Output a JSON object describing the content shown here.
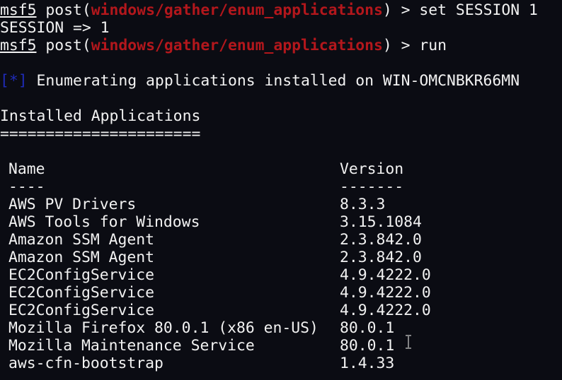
{
  "terminal": {
    "lines": {
      "cmd1": {
        "prompt": "msf5",
        "post_prefix": " post(",
        "module": "windows/gather/enum_applications",
        "post_suffix": ") > ",
        "command": "set SESSION 1"
      },
      "output1": "SESSION => 1",
      "cmd2": {
        "prompt": "msf5",
        "post_prefix": " post(",
        "module": "windows/gather/enum_applications",
        "post_suffix": ") > ",
        "command": "run"
      },
      "status": {
        "marker": "[*]",
        "text": " Enumerating applications installed on WIN-OMCNBKR66MN"
      },
      "section_title": "Installed Applications",
      "section_underline": "======================"
    },
    "table": {
      "headers": {
        "name": "Name",
        "version": "Version",
        "name_rule": "----",
        "version_rule": "-------"
      },
      "rows": [
        {
          "name": "AWS PV Drivers",
          "version": "8.3.3"
        },
        {
          "name": "AWS Tools for Windows",
          "version": "3.15.1084"
        },
        {
          "name": "Amazon SSM Agent",
          "version": "2.3.842.0"
        },
        {
          "name": "Amazon SSM Agent",
          "version": "2.3.842.0"
        },
        {
          "name": "EC2ConfigService",
          "version": "4.9.4222.0"
        },
        {
          "name": "EC2ConfigService",
          "version": "4.9.4222.0"
        },
        {
          "name": "EC2ConfigService",
          "version": "4.9.4222.0"
        },
        {
          "name": "Mozilla Firefox 80.0.1 (x86 en-US)",
          "version": "80.0.1"
        },
        {
          "name": "Mozilla Maintenance Service",
          "version": "80.0.1"
        },
        {
          "name": "aws-cfn-bootstrap",
          "version": "1.4.33"
        }
      ]
    },
    "colors": {
      "background": "#0b0c13",
      "foreground": "#f2f2f2",
      "module": "#b3171c",
      "status_marker": "#1f2bb8"
    },
    "mouse_cursor": "ibeam-cursor-icon"
  }
}
